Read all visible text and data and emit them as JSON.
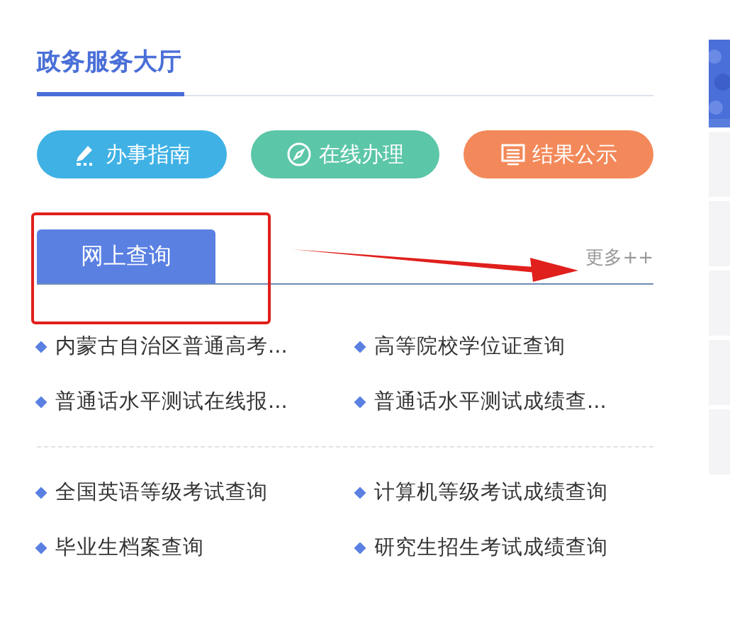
{
  "section": {
    "title": "政务服务大厅"
  },
  "buttons": [
    {
      "label": "办事指南",
      "kind": "guide",
      "color": "#3fb1e5"
    },
    {
      "label": "在线办理",
      "kind": "online",
      "color": "#5cc6a8"
    },
    {
      "label": "结果公示",
      "kind": "notice",
      "color": "#f3895a"
    }
  ],
  "tabs": [
    {
      "label": "网上查询",
      "selected": true
    }
  ],
  "more_link": "更多++",
  "link_groups": [
    [
      "内蒙古自治区普通高考...",
      "高等院校学位证查询",
      "普通话水平测试在线报...",
      "普通话水平测试成绩查..."
    ],
    [
      "全国英语等级考试查询",
      "计算机等级考试成绩查询",
      "毕业生档案查询",
      "研究生招生考试成绩查询"
    ]
  ]
}
